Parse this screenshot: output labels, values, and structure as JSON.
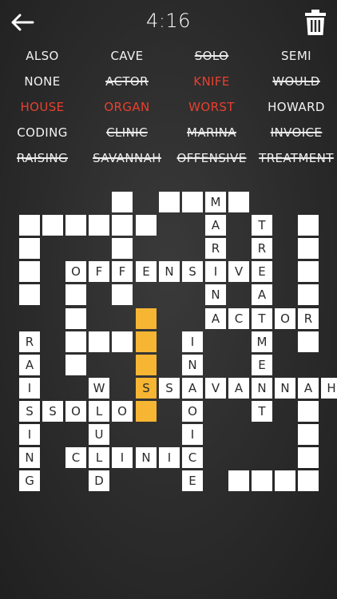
{
  "header": {
    "timer": "4:16"
  },
  "words": [
    {
      "text": "ALSO",
      "status": "normal"
    },
    {
      "text": "CAVE",
      "status": "normal"
    },
    {
      "text": "SOLO",
      "status": "done"
    },
    {
      "text": "SEMI",
      "status": "normal"
    },
    {
      "text": "NONE",
      "status": "normal"
    },
    {
      "text": "ACTOR",
      "status": "done"
    },
    {
      "text": "KNIFE",
      "status": "red"
    },
    {
      "text": "WOULD",
      "status": "done"
    },
    {
      "text": "HOUSE",
      "status": "red"
    },
    {
      "text": "ORGAN",
      "status": "red"
    },
    {
      "text": "WORST",
      "status": "red"
    },
    {
      "text": "HOWARD",
      "status": "normal"
    },
    {
      "text": "CODING",
      "status": "normal"
    },
    {
      "text": "CLINIC",
      "status": "done"
    },
    {
      "text": "MARINA",
      "status": "done"
    },
    {
      "text": "INVOICE",
      "status": "done"
    },
    {
      "text": "RAISING",
      "status": "done"
    },
    {
      "text": "SAVANNAH",
      "status": "done"
    },
    {
      "text": "OFFENSIVE",
      "status": "done"
    },
    {
      "text": "TREATMENT",
      "status": "done"
    }
  ],
  "grid": {
    "cells": [
      {
        "r": 0,
        "c": 4,
        "ch": ""
      },
      {
        "r": 0,
        "c": 6,
        "ch": ""
      },
      {
        "r": 0,
        "c": 7,
        "ch": ""
      },
      {
        "r": 0,
        "c": 8,
        "ch": "M"
      },
      {
        "r": 0,
        "c": 9,
        "ch": ""
      },
      {
        "r": 1,
        "c": 0,
        "ch": ""
      },
      {
        "r": 1,
        "c": 1,
        "ch": ""
      },
      {
        "r": 1,
        "c": 2,
        "ch": ""
      },
      {
        "r": 1,
        "c": 3,
        "ch": ""
      },
      {
        "r": 1,
        "c": 4,
        "ch": ""
      },
      {
        "r": 1,
        "c": 5,
        "ch": ""
      },
      {
        "r": 1,
        "c": 8,
        "ch": "A"
      },
      {
        "r": 1,
        "c": 10,
        "ch": "T"
      },
      {
        "r": 1,
        "c": 12,
        "ch": ""
      },
      {
        "r": 2,
        "c": 0,
        "ch": ""
      },
      {
        "r": 2,
        "c": 4,
        "ch": ""
      },
      {
        "r": 2,
        "c": 8,
        "ch": "R"
      },
      {
        "r": 2,
        "c": 10,
        "ch": "R"
      },
      {
        "r": 2,
        "c": 12,
        "ch": ""
      },
      {
        "r": 3,
        "c": 0,
        "ch": ""
      },
      {
        "r": 3,
        "c": 2,
        "ch": "O"
      },
      {
        "r": 3,
        "c": 3,
        "ch": "F"
      },
      {
        "r": 3,
        "c": 4,
        "ch": "F"
      },
      {
        "r": 3,
        "c": 5,
        "ch": "E"
      },
      {
        "r": 3,
        "c": 6,
        "ch": "N"
      },
      {
        "r": 3,
        "c": 7,
        "ch": "S"
      },
      {
        "r": 3,
        "c": 8,
        "ch": "I"
      },
      {
        "r": 3,
        "c": 9,
        "ch": "V"
      },
      {
        "r": 3,
        "c": 10,
        "ch": "E"
      },
      {
        "r": 3,
        "c": 12,
        "ch": ""
      },
      {
        "r": 4,
        "c": 0,
        "ch": ""
      },
      {
        "r": 4,
        "c": 2,
        "ch": ""
      },
      {
        "r": 4,
        "c": 4,
        "ch": ""
      },
      {
        "r": 4,
        "c": 8,
        "ch": "N"
      },
      {
        "r": 4,
        "c": 10,
        "ch": "A"
      },
      {
        "r": 4,
        "c": 12,
        "ch": ""
      },
      {
        "r": 5,
        "c": 2,
        "ch": ""
      },
      {
        "r": 5,
        "c": 5,
        "ch": "",
        "sel": true
      },
      {
        "r": 5,
        "c": 8,
        "ch": "A"
      },
      {
        "r": 5,
        "c": 9,
        "ch": "C"
      },
      {
        "r": 5,
        "c": 10,
        "ch": "T"
      },
      {
        "r": 5,
        "c": 11,
        "ch": "O"
      },
      {
        "r": 5,
        "c": 12,
        "ch": "R"
      },
      {
        "r": 6,
        "c": 0,
        "ch": "R"
      },
      {
        "r": 6,
        "c": 2,
        "ch": ""
      },
      {
        "r": 6,
        "c": 3,
        "ch": ""
      },
      {
        "r": 6,
        "c": 4,
        "ch": ""
      },
      {
        "r": 6,
        "c": 5,
        "ch": "",
        "sel": true
      },
      {
        "r": 6,
        "c": 7,
        "ch": "I"
      },
      {
        "r": 6,
        "c": 10,
        "ch": "M"
      },
      {
        "r": 6,
        "c": 12,
        "ch": ""
      },
      {
        "r": 7,
        "c": 0,
        "ch": "A"
      },
      {
        "r": 7,
        "c": 2,
        "ch": ""
      },
      {
        "r": 7,
        "c": 5,
        "ch": "",
        "sel": true
      },
      {
        "r": 7,
        "c": 7,
        "ch": "N"
      },
      {
        "r": 7,
        "c": 10,
        "ch": "E"
      },
      {
        "r": 8,
        "c": 0,
        "ch": "I"
      },
      {
        "r": 8,
        "c": 3,
        "ch": "W"
      },
      {
        "r": 8,
        "c": 5,
        "ch": "S",
        "sel": true
      },
      {
        "r": 8,
        "c": 6,
        "ch": "S"
      },
      {
        "r": 8,
        "c": 7,
        "ch": "A"
      },
      {
        "r": 8,
        "c": 8,
        "ch": "V"
      },
      {
        "r": 8,
        "c": 9,
        "ch": "A"
      },
      {
        "r": 8,
        "c": 10,
        "ch": "N"
      },
      {
        "r": 8,
        "c": 11,
        "ch": "N"
      },
      {
        "r": 8,
        "c": 12,
        "ch": "A"
      },
      {
        "r": 8,
        "c": 13,
        "ch": "H"
      },
      {
        "r": 9,
        "c": 0,
        "ch": "S"
      },
      {
        "r": 9,
        "c": 1,
        "ch": "S"
      },
      {
        "r": 9,
        "c": 2,
        "ch": "O"
      },
      {
        "r": 9,
        "c": 3,
        "ch": "L"
      },
      {
        "r": 9,
        "c": 4,
        "ch": "O"
      },
      {
        "r": 9,
        "c": 5,
        "ch": "",
        "sel": true
      },
      {
        "r": 9,
        "c": 7,
        "ch": "O"
      },
      {
        "r": 9,
        "c": 10,
        "ch": "T"
      },
      {
        "r": 9,
        "c": 12,
        "ch": ""
      },
      {
        "r": 10,
        "c": 0,
        "ch": "I"
      },
      {
        "r": 10,
        "c": 3,
        "ch": "U"
      },
      {
        "r": 10,
        "c": 7,
        "ch": "I"
      },
      {
        "r": 10,
        "c": 12,
        "ch": ""
      },
      {
        "r": 11,
        "c": 0,
        "ch": "N"
      },
      {
        "r": 11,
        "c": 2,
        "ch": "C"
      },
      {
        "r": 11,
        "c": 3,
        "ch": "L"
      },
      {
        "r": 11,
        "c": 4,
        "ch": "I"
      },
      {
        "r": 11,
        "c": 5,
        "ch": "N"
      },
      {
        "r": 11,
        "c": 6,
        "ch": "I"
      },
      {
        "r": 11,
        "c": 7,
        "ch": "C"
      },
      {
        "r": 11,
        "c": 12,
        "ch": ""
      },
      {
        "r": 12,
        "c": 0,
        "ch": "G"
      },
      {
        "r": 12,
        "c": 3,
        "ch": "D"
      },
      {
        "r": 12,
        "c": 7,
        "ch": "E"
      },
      {
        "r": 12,
        "c": 9,
        "ch": ""
      },
      {
        "r": 12,
        "c": 10,
        "ch": ""
      },
      {
        "r": 12,
        "c": 11,
        "ch": ""
      },
      {
        "r": 12,
        "c": 12,
        "ch": ""
      }
    ]
  }
}
